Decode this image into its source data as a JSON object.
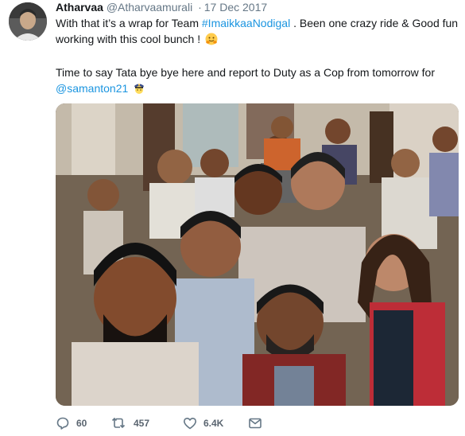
{
  "tweet": {
    "display_name": "Atharvaa",
    "handle": "@Atharvaamurali",
    "separator": "·",
    "date": "17 Dec 2017",
    "line1_prefix": "With that it’s a wrap for Team ",
    "hashtag": "#ImaikkaaNodigal",
    "line1_suffix": " . Been one crazy ride & Good fun",
    "line2": "working with this cool bunch !",
    "line3": "Time to say Tata bye bye here and report to Duty as a Cop from tomorrow for",
    "mention": "@samanton21"
  },
  "actions": {
    "reply_count": "60",
    "retweet_count": "457",
    "like_count": "6.4K"
  },
  "icons": {
    "reply": "reply-icon",
    "retweet": "retweet-icon",
    "like": "like-icon",
    "message": "direct-message-icon",
    "hug_emoji": "hugging-face-emoji",
    "police_emoji": "police-officer-emoji"
  },
  "colors": {
    "link": "#1b95e0",
    "meta": "#657786",
    "text": "#14171a"
  }
}
